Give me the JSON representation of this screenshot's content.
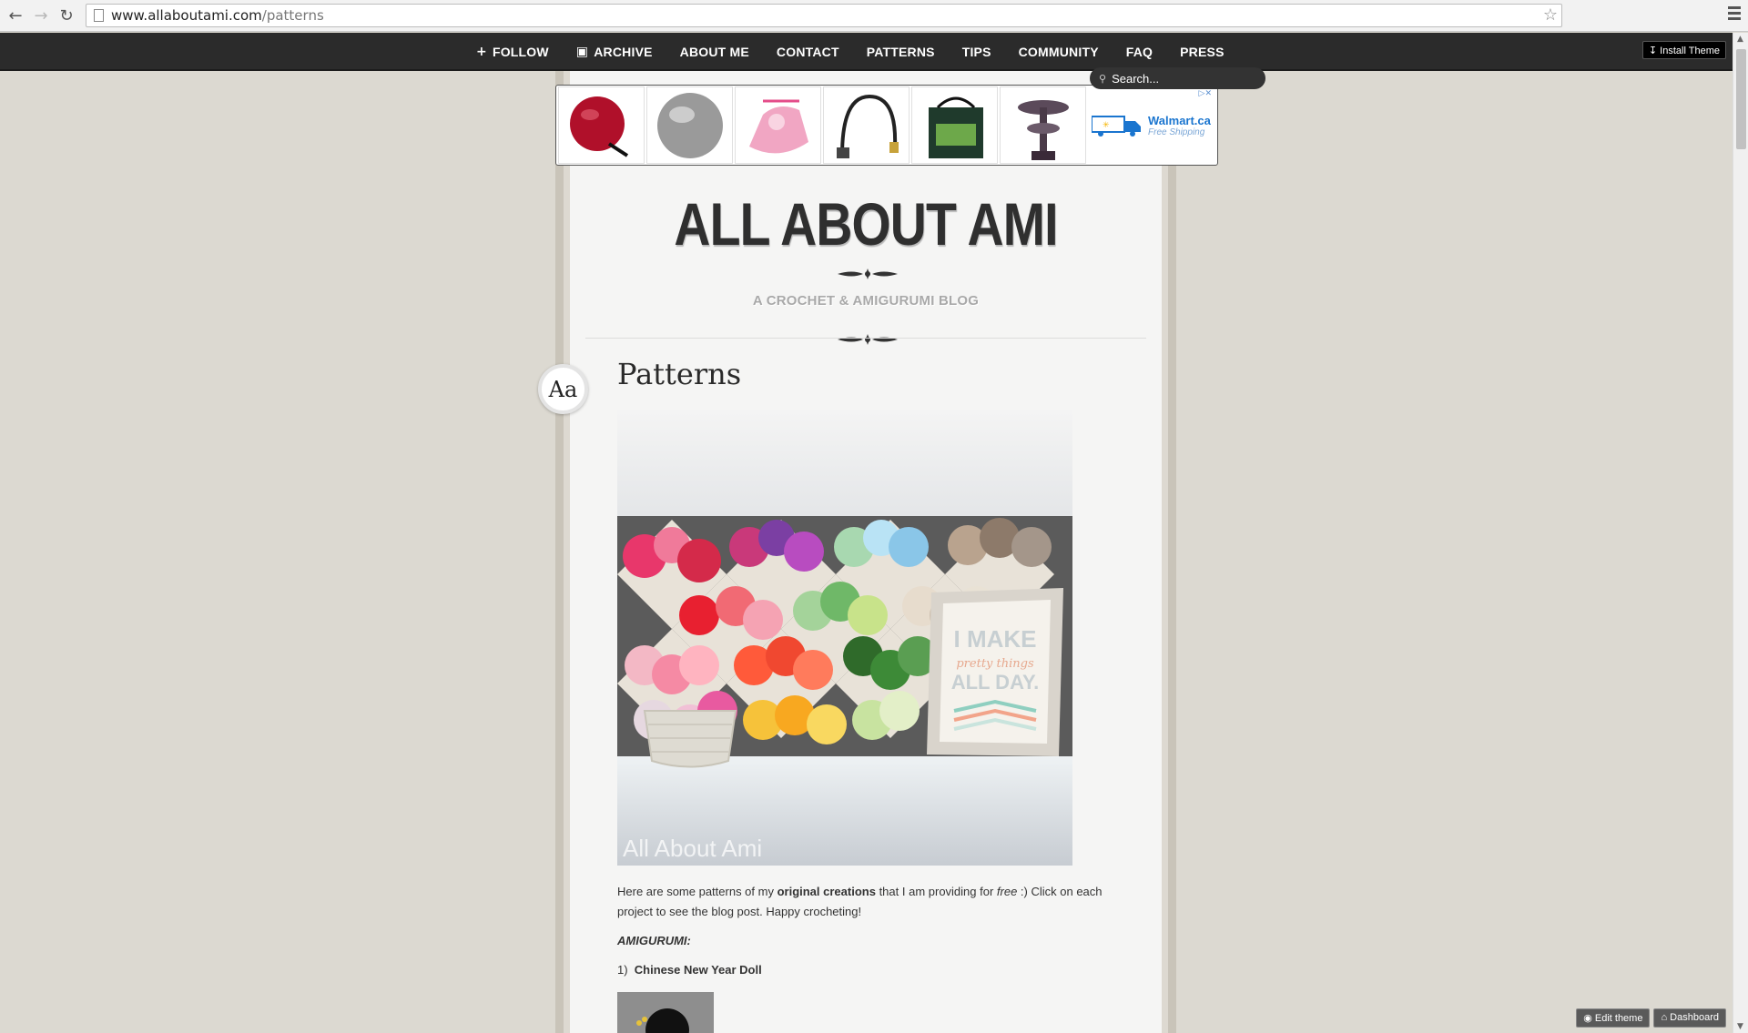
{
  "browser": {
    "url_host": "www.allaboutami.com",
    "url_path": "/patterns",
    "back_icon": "back-arrow-icon",
    "forward_icon": "forward-arrow-icon",
    "reload_icon": "reload-icon"
  },
  "nav": {
    "follow": "FOLLOW",
    "archive": "ARCHIVE",
    "about": "ABOUT ME",
    "contact": "CONTACT",
    "patterns": "PATTERNS",
    "tips": "TIPS",
    "community": "COMMUNITY",
    "faq": "FAQ",
    "press": "PRESS",
    "install_theme": "Install Theme",
    "search_placeholder": "Search..."
  },
  "ad": {
    "walmart_name": "Walmart.ca",
    "walmart_tagline": "Free Shipping"
  },
  "blog": {
    "title": "ALL ABOUT AMI",
    "tagline": "A CROCHET & AMIGURUMI BLOG",
    "font_toggle": "Aa"
  },
  "post": {
    "title": "Patterns",
    "watermark": "All About Ami",
    "print_line1": "I MAKE",
    "print_line2": "pretty things",
    "print_line3": "ALL DAY.",
    "intro_1": "Here are some patterns of my ",
    "intro_bold": "original creations",
    "intro_2": " that I am providing for ",
    "intro_italic": "free",
    "intro_3": " :)  Click on each project to see the blog post.  Happy crocheting!",
    "section_heading": "AMIGURUMI:",
    "item_1_number": "1)",
    "item_1_title": "Chinese New Year Doll"
  },
  "footer": {
    "edit_theme": "Edit theme",
    "dashboard": "Dashboard"
  },
  "colors": {
    "nav_bg": "#2b2b2b",
    "page_bg": "#dcd9d1",
    "paper_bg": "#f5f5f4",
    "title_color": "#2f2f2f",
    "tagline_color": "#a9a9a9"
  }
}
